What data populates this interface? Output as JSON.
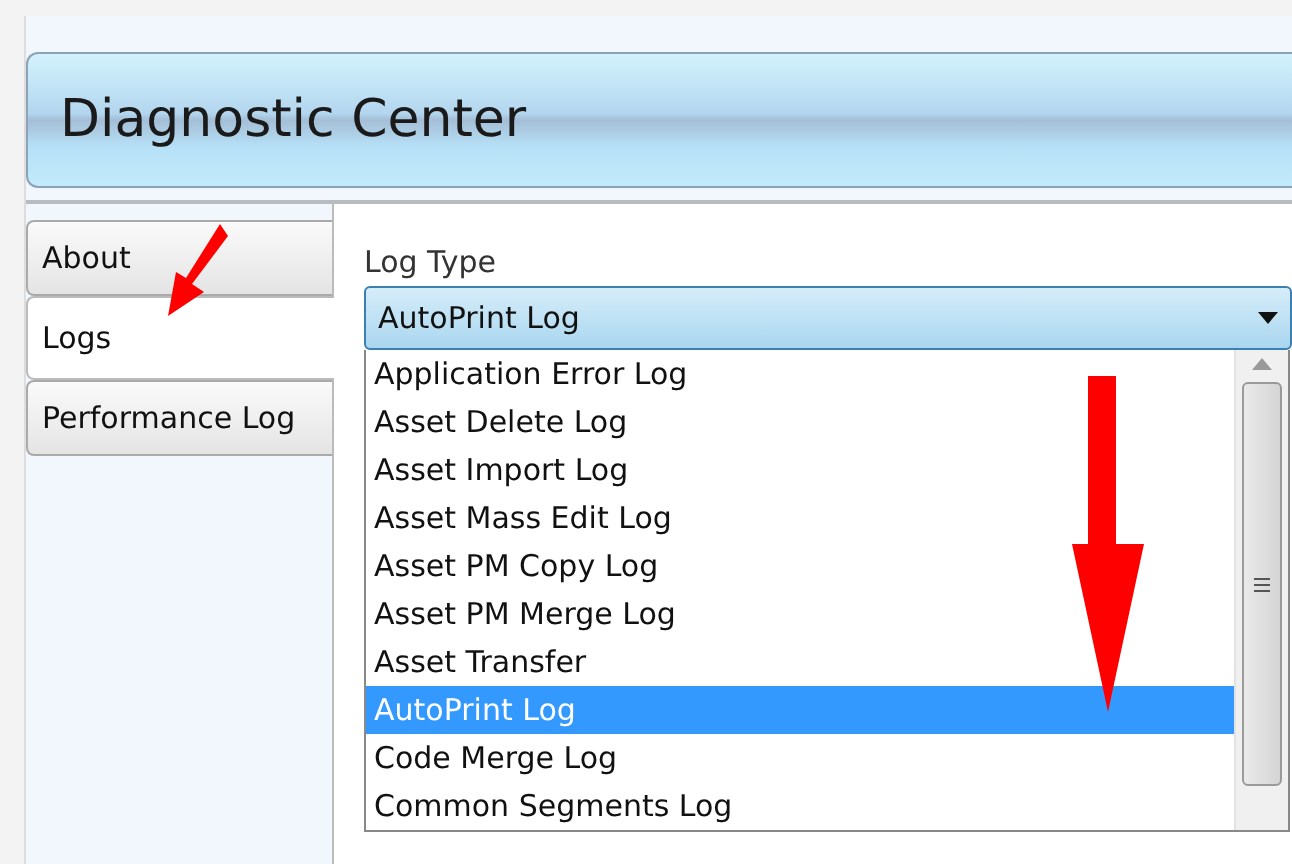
{
  "window": {
    "title": "Diagnostic Center"
  },
  "tabs": [
    {
      "label": "About",
      "selected": false
    },
    {
      "label": "Logs",
      "selected": true
    },
    {
      "label": "Performance Log",
      "selected": false
    }
  ],
  "log_type": {
    "label": "Log Type",
    "value": "AutoPrint Log",
    "expanded": true,
    "options": [
      {
        "label": "Application Error Log",
        "selected": false
      },
      {
        "label": "Asset Delete Log",
        "selected": false
      },
      {
        "label": "Asset Import Log",
        "selected": false
      },
      {
        "label": "Asset Mass Edit Log",
        "selected": false
      },
      {
        "label": "Asset PM Copy Log",
        "selected": false
      },
      {
        "label": "Asset PM Merge Log",
        "selected": false
      },
      {
        "label": "Asset Transfer",
        "selected": false
      },
      {
        "label": "AutoPrint Log",
        "selected": true
      },
      {
        "label": "Code Merge Log",
        "selected": false
      },
      {
        "label": "Common Segments Log",
        "selected": false
      }
    ]
  }
}
